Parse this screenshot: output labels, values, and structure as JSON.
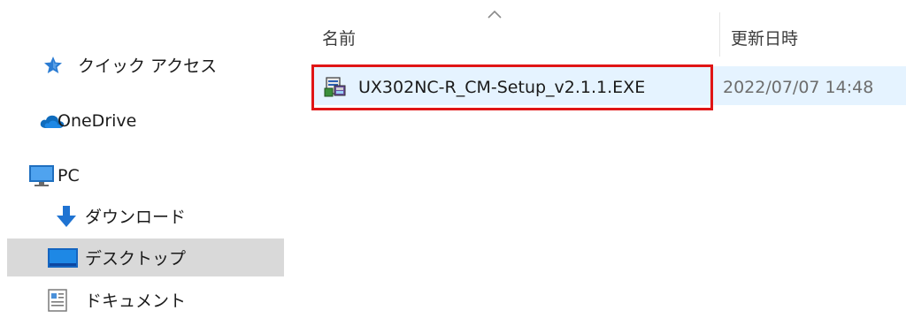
{
  "navigation": {
    "quick_access": {
      "label": "クイック アクセス",
      "icon": "star-pin-icon"
    },
    "onedrive": {
      "label": "OneDrive",
      "icon": "cloud-icon"
    },
    "pc": {
      "label": "PC",
      "icon": "monitor-icon"
    },
    "downloads": {
      "label": "ダウンロード",
      "icon": "download-arrow-icon"
    },
    "desktop": {
      "label": "デスクトップ",
      "icon": "desktop-icon",
      "selected": true
    },
    "documents": {
      "label": "ドキュメント",
      "icon": "document-icon"
    }
  },
  "file_list": {
    "columns": {
      "name": "名前",
      "modified": "更新日時"
    },
    "sort_indicator": "ascending",
    "rows": [
      {
        "name": "UX302NC-R_CM-Setup_v2.1.1.EXE",
        "modified": "2022/07/07 14:48",
        "icon": "installer-exe-icon",
        "highlighted": true
      }
    ]
  },
  "colors": {
    "highlight_box": "#e01515",
    "row_hover": "#e5f3ff",
    "nav_selected": "#d9d9d9",
    "accent_blue": "#0078d7"
  }
}
